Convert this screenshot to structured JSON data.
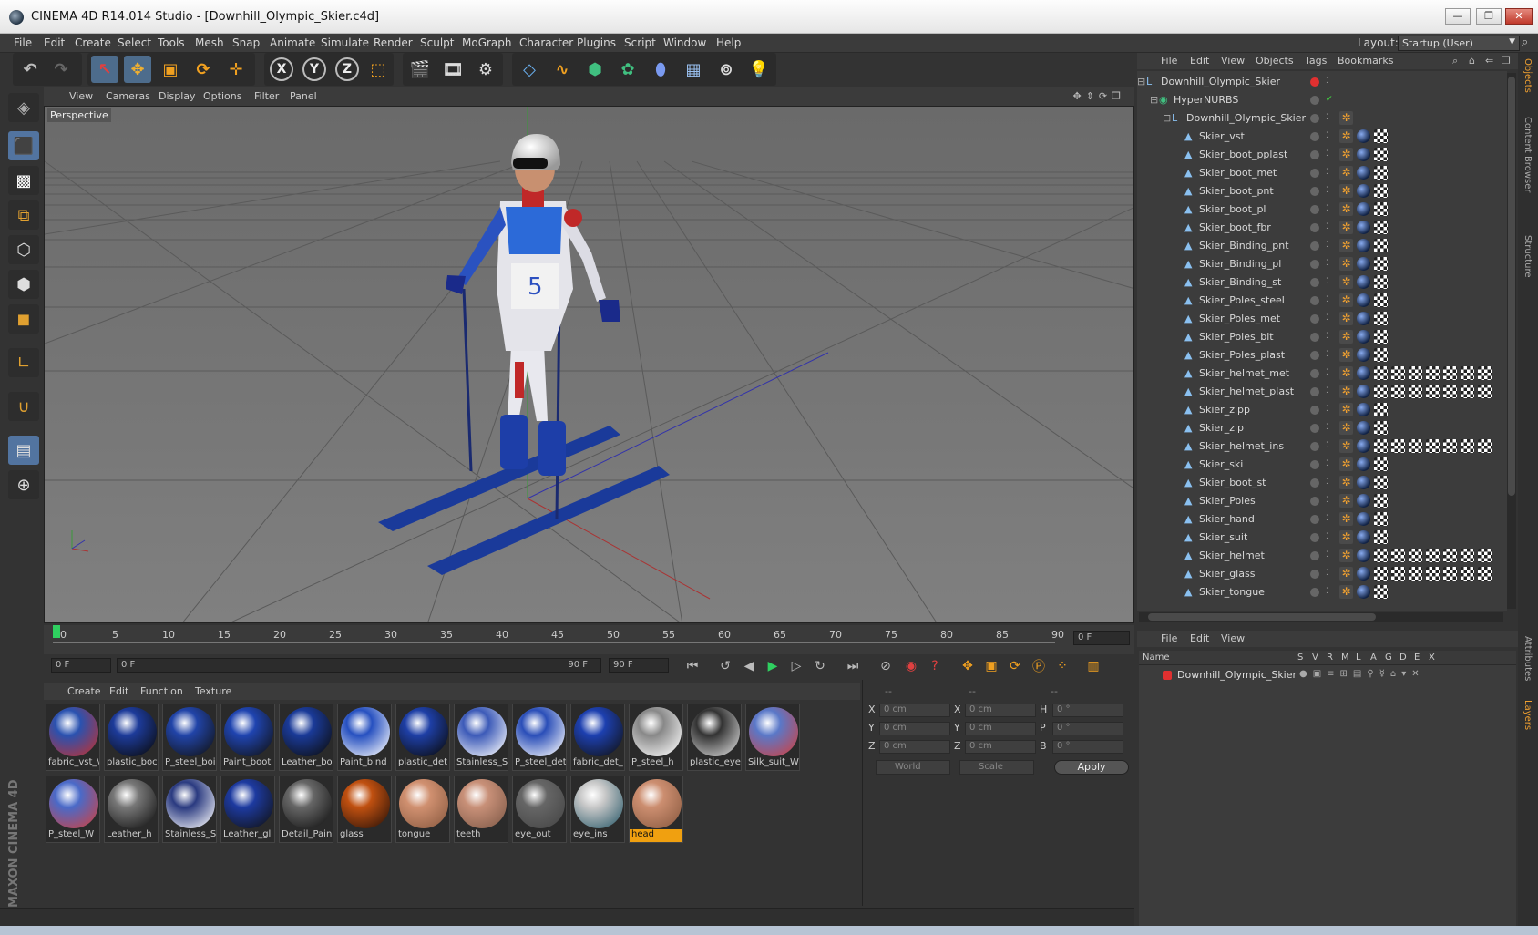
{
  "window": {
    "title": "CINEMA 4D R14.014 Studio - [Downhill_Olympic_Skier.c4d]",
    "min_label": "—",
    "max_label": "❐",
    "close_label": "✕"
  },
  "menubar": {
    "items": [
      "File",
      "Edit",
      "Create",
      "Select",
      "Tools",
      "Mesh",
      "Snap",
      "Animate",
      "Simulate",
      "Render",
      "Sculpt",
      "MoGraph",
      "Character",
      "Plugins",
      "Script",
      "Window",
      "Help"
    ],
    "layout_label": "Layout:",
    "layout_value": "Startup (User)"
  },
  "viewport": {
    "menu": [
      "View",
      "Cameras",
      "Display",
      "Options",
      "Filter",
      "Panel"
    ],
    "label": "Perspective",
    "bib_number": "5"
  },
  "timeline": {
    "ticks": [
      "0",
      "5",
      "10",
      "15",
      "20",
      "25",
      "30",
      "35",
      "40",
      "45",
      "50",
      "55",
      "60",
      "65",
      "70",
      "75",
      "80",
      "85",
      "90"
    ],
    "current_frame": "0 F",
    "start_frame": "0 F",
    "range_start": "0 F",
    "range_end": "90 F",
    "end_frame": "90 F"
  },
  "materials": {
    "menu": [
      "Create",
      "Edit",
      "Function",
      "Texture"
    ],
    "items": [
      {
        "label": "fabric_vst_\\",
        "color": "#2a52b0",
        "accent": "#c03030"
      },
      {
        "label": "plastic_boc",
        "color": "#1d3b9a",
        "accent": "#0a0a0a"
      },
      {
        "label": "P_steel_boi",
        "color": "#2144a8",
        "accent": "#111111"
      },
      {
        "label": "Paint_boot",
        "color": "#1f44b0",
        "accent": "#111111"
      },
      {
        "label": "Leather_bo",
        "color": "#1a3a98",
        "accent": "#0d0d0d"
      },
      {
        "label": "Paint_bind",
        "color": "#2650c0",
        "accent": "#ffffff"
      },
      {
        "label": "plastic_det",
        "color": "#1e3fa6",
        "accent": "#0a0a0a"
      },
      {
        "label": "Stainless_S",
        "color": "#3c5ab8",
        "accent": "#ffffff"
      },
      {
        "label": "P_steel_det",
        "color": "#2a4eb8",
        "accent": "#ffffff"
      },
      {
        "label": "fabric_det_",
        "color": "#1d40b0",
        "accent": "#111111"
      },
      {
        "label": "P_steel_h",
        "color": "#888888",
        "accent": "#ffffff"
      },
      {
        "label": "plastic_eye",
        "color": "#333333",
        "accent": "#dddddd"
      },
      {
        "label": "Silk_suit_W",
        "color": "#5a78c8",
        "accent": "#d04040"
      },
      {
        "label": "P_steel_W",
        "color": "#4a6ac8",
        "accent": "#d04040"
      },
      {
        "label": "Leather_h",
        "color": "#777777",
        "accent": "#111111"
      },
      {
        "label": "Stainless_S",
        "color": "#2a3a80",
        "accent": "#ffffff"
      },
      {
        "label": "Leather_gl",
        "color": "#1d3aa0",
        "accent": "#111111"
      },
      {
        "label": "Detail_Pain",
        "color": "#666666",
        "accent": "#111111"
      },
      {
        "label": "glass",
        "color": "#c05010",
        "accent": "#2a1208"
      },
      {
        "label": "tongue",
        "color": "#d09070",
        "accent": "#8a5a40"
      },
      {
        "label": "teeth",
        "color": "#c89078",
        "accent": "#805a48"
      },
      {
        "label": "eye_out",
        "color": "#666666",
        "accent": "#444444"
      },
      {
        "label": "eye_ins",
        "color": "#c8c8c8",
        "accent": "#2a5a6a"
      },
      {
        "label": "head",
        "color": "#cc8e70",
        "accent": "#8a5a40"
      }
    ]
  },
  "coordinates": {
    "header": [
      "--",
      "--",
      "--"
    ],
    "rows": [
      {
        "a": "X",
        "pos": "0 cm",
        "b": "X",
        "size": "0 cm",
        "c": "H",
        "rot": "0 °"
      },
      {
        "a": "Y",
        "pos": "0 cm",
        "b": "Y",
        "size": "0 cm",
        "c": "P",
        "rot": "0 °"
      },
      {
        "a": "Z",
        "pos": "0 cm",
        "b": "Z",
        "size": "0 cm",
        "c": "B",
        "rot": "0 °"
      }
    ],
    "mode": "World",
    "scale": "Scale",
    "apply": "Apply"
  },
  "objects": {
    "menu": [
      "File",
      "Edit",
      "View",
      "Objects",
      "Tags",
      "Bookmarks"
    ],
    "items": [
      {
        "name": "Downhill_Olympic_Skier",
        "depth": 0,
        "icon": "null",
        "tags": []
      },
      {
        "name": "HyperNURBS",
        "depth": 1,
        "icon": "nurbs",
        "tags": []
      },
      {
        "name": "Downhill_Olympic_Skier",
        "depth": 2,
        "icon": "null",
        "tags": [
          "gear"
        ]
      },
      {
        "name": "Skier_vst",
        "depth": 3,
        "icon": "poly",
        "tags": [
          "gear",
          "sph",
          "check"
        ]
      },
      {
        "name": "Skier_boot_pplast",
        "depth": 3,
        "icon": "poly",
        "tags": [
          "gear",
          "sph",
          "check"
        ]
      },
      {
        "name": "Skier_boot_met",
        "depth": 3,
        "icon": "poly",
        "tags": [
          "gear",
          "sph",
          "check"
        ]
      },
      {
        "name": "Skier_boot_pnt",
        "depth": 3,
        "icon": "poly",
        "tags": [
          "gear",
          "sph",
          "check"
        ]
      },
      {
        "name": "Skier_boot_pl",
        "depth": 3,
        "icon": "poly",
        "tags": [
          "gear",
          "sph",
          "check"
        ]
      },
      {
        "name": "Skier_boot_fbr",
        "depth": 3,
        "icon": "poly",
        "tags": [
          "gear",
          "sph",
          "check"
        ]
      },
      {
        "name": "Skier_Binding_pnt",
        "depth": 3,
        "icon": "poly",
        "tags": [
          "gear",
          "sph",
          "check"
        ]
      },
      {
        "name": "Skier_Binding_pl",
        "depth": 3,
        "icon": "poly",
        "tags": [
          "gear",
          "sph",
          "check"
        ]
      },
      {
        "name": "Skier_Binding_st",
        "depth": 3,
        "icon": "poly",
        "tags": [
          "gear",
          "sph",
          "check"
        ]
      },
      {
        "name": "Skier_Poles_steel",
        "depth": 3,
        "icon": "poly",
        "tags": [
          "gear",
          "sph",
          "check"
        ]
      },
      {
        "name": "Skier_Poles_met",
        "depth": 3,
        "icon": "poly",
        "tags": [
          "gear",
          "sph",
          "check"
        ]
      },
      {
        "name": "Skier_Poles_blt",
        "depth": 3,
        "icon": "poly",
        "tags": [
          "gear",
          "sph",
          "check"
        ]
      },
      {
        "name": "Skier_Poles_plast",
        "depth": 3,
        "icon": "poly",
        "tags": [
          "gear",
          "sph",
          "check"
        ]
      },
      {
        "name": "Skier_helmet_met",
        "depth": 3,
        "icon": "poly",
        "tags": [
          "gear",
          "sph",
          "check",
          "check",
          "check",
          "check",
          "check",
          "check",
          "check"
        ]
      },
      {
        "name": "Skier_helmet_plast",
        "depth": 3,
        "icon": "poly",
        "tags": [
          "gear",
          "sph",
          "check",
          "check",
          "check",
          "check",
          "check",
          "check",
          "check"
        ]
      },
      {
        "name": "Skier_zipp",
        "depth": 3,
        "icon": "poly",
        "tags": [
          "gear",
          "sph",
          "check"
        ]
      },
      {
        "name": "Skier_zip",
        "depth": 3,
        "icon": "poly",
        "tags": [
          "gear",
          "sph",
          "check"
        ]
      },
      {
        "name": "Skier_helmet_ins",
        "depth": 3,
        "icon": "poly",
        "tags": [
          "gear",
          "sph",
          "check",
          "check",
          "check",
          "check",
          "check",
          "check",
          "check"
        ]
      },
      {
        "name": "Skier_ski",
        "depth": 3,
        "icon": "poly",
        "tags": [
          "gear",
          "sph",
          "check"
        ]
      },
      {
        "name": "Skier_boot_st",
        "depth": 3,
        "icon": "poly",
        "tags": [
          "gear",
          "sph",
          "check"
        ]
      },
      {
        "name": "Skier_Poles",
        "depth": 3,
        "icon": "poly",
        "tags": [
          "gear",
          "sph",
          "check"
        ]
      },
      {
        "name": "Skier_hand",
        "depth": 3,
        "icon": "poly",
        "tags": [
          "gear",
          "sph",
          "check"
        ]
      },
      {
        "name": "Skier_suit",
        "depth": 3,
        "icon": "poly",
        "tags": [
          "gear",
          "sph",
          "check"
        ]
      },
      {
        "name": "Skier_helmet",
        "depth": 3,
        "icon": "poly",
        "tags": [
          "gear",
          "sph",
          "check",
          "check",
          "check",
          "check",
          "check",
          "check",
          "check"
        ]
      },
      {
        "name": "Skier_glass",
        "depth": 3,
        "icon": "poly",
        "tags": [
          "gear",
          "sph",
          "check",
          "check",
          "check",
          "check",
          "check",
          "check",
          "check"
        ]
      },
      {
        "name": "Skier_tongue",
        "depth": 3,
        "icon": "poly",
        "tags": [
          "gear",
          "sph",
          "check"
        ]
      }
    ]
  },
  "layers": {
    "menu": [
      "File",
      "Edit",
      "View"
    ],
    "headers": [
      "Name",
      "S",
      "V",
      "R",
      "M",
      "L",
      "A",
      "G",
      "D",
      "E",
      "X"
    ],
    "items": [
      {
        "name": "Downhill_Olympic_Skier",
        "color": "#e03030"
      }
    ]
  },
  "right_tabs": [
    "Objects",
    "Content Browser",
    "Structure",
    "Attributes",
    "Layers"
  ],
  "brand": "MAXON CINEMA 4D",
  "colors": {
    "accent": "#f0a010",
    "active_tool": "#5274a0",
    "layer_red": "#e03030"
  }
}
